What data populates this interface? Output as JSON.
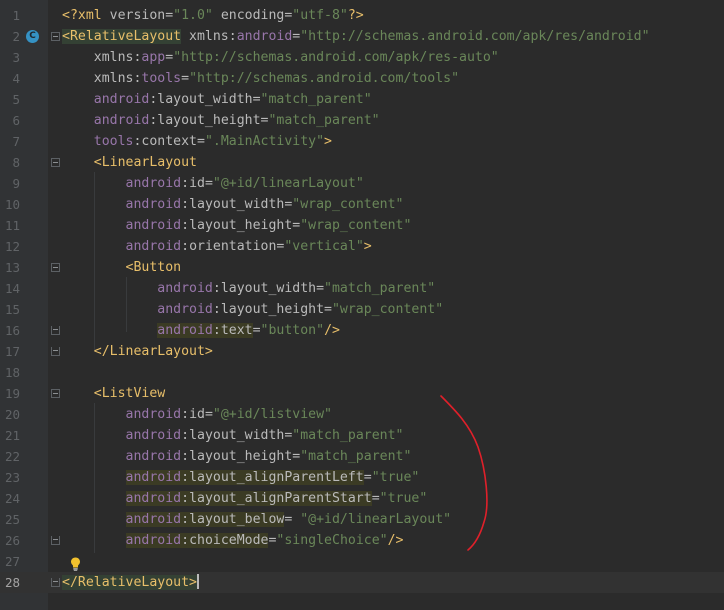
{
  "editor": {
    "language": "xml",
    "current_line": 28,
    "lines": [
      {
        "n": "1",
        "text": "<?xml version=\"1.0\" encoding=\"utf-8\"?>"
      },
      {
        "n": "2",
        "text": "<RelativeLayout xmlns:android=\"http://schemas.android.com/apk/res/android\""
      },
      {
        "n": "3",
        "text": "    xmlns:app=\"http://schemas.android.com/apk/res-auto\""
      },
      {
        "n": "4",
        "text": "    xmlns:tools=\"http://schemas.android.com/tools\""
      },
      {
        "n": "5",
        "text": "    android:layout_width=\"match_parent\""
      },
      {
        "n": "6",
        "text": "    android:layout_height=\"match_parent\""
      },
      {
        "n": "7",
        "text": "    tools:context=\".MainActivity\">"
      },
      {
        "n": "8",
        "text": "    <LinearLayout"
      },
      {
        "n": "9",
        "text": "        android:id=\"@+id/linearLayout\""
      },
      {
        "n": "10",
        "text": "        android:layout_width=\"wrap_content\""
      },
      {
        "n": "11",
        "text": "        android:layout_height=\"wrap_content\""
      },
      {
        "n": "12",
        "text": "        android:orientation=\"vertical\">"
      },
      {
        "n": "13",
        "text": "        <Button"
      },
      {
        "n": "14",
        "text": "            android:layout_width=\"match_parent\""
      },
      {
        "n": "15",
        "text": "            android:layout_height=\"wrap_content\""
      },
      {
        "n": "16",
        "text": "            android:text=\"button\"/>"
      },
      {
        "n": "17",
        "text": "    </LinearLayout>"
      },
      {
        "n": "18",
        "text": ""
      },
      {
        "n": "19",
        "text": "    <ListView"
      },
      {
        "n": "20",
        "text": "        android:id=\"@+id/listview\""
      },
      {
        "n": "21",
        "text": "        android:layout_width=\"match_parent\""
      },
      {
        "n": "22",
        "text": "        android:layout_height=\"match_parent\""
      },
      {
        "n": "23",
        "text": "        android:layout_alignParentLeft=\"true\""
      },
      {
        "n": "24",
        "text": "        android:layout_alignParentStart=\"true\""
      },
      {
        "n": "25",
        "text": "        android:layout_below= \"@+id/linearLayout\""
      },
      {
        "n": "26",
        "text": "        android:choiceMode=\"singleChoice\"/>"
      },
      {
        "n": "27",
        "text": ""
      },
      {
        "n": "28",
        "text": "</RelativeLayout>"
      }
    ]
  },
  "gutter": {
    "class_icon_letter": "C",
    "intention_icon": "lightbulb-icon"
  },
  "colors": {
    "background": "#2b2b2b",
    "tag": "#e8bf6a",
    "namespace": "#9876aa",
    "attribute": "#bababa",
    "value": "#6a8759",
    "annotation_stroke": "#e0202a"
  }
}
